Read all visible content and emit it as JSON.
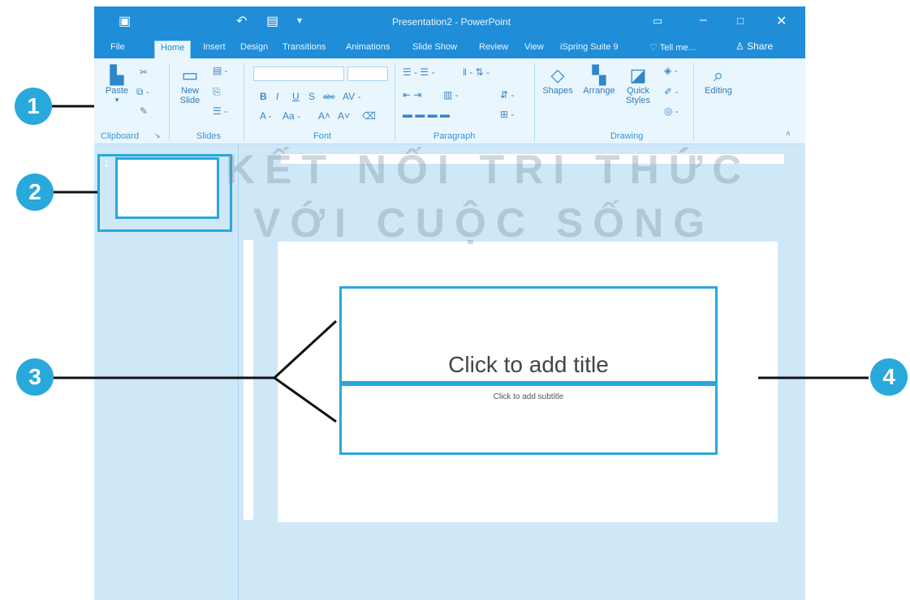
{
  "window": {
    "title": "Presentation2 - PowerPoint",
    "tabs": [
      "File",
      "Home",
      "Insert",
      "Design",
      "Transitions",
      "Animations",
      "Slide Show",
      "Review",
      "View",
      "iSpring Suite 9",
      "Tell me..."
    ],
    "active_tab": "Home",
    "share_label": "Share"
  },
  "ribbon": {
    "groups": [
      "Clipboard",
      "Slides",
      "Font",
      "Paragraph",
      "Drawing"
    ],
    "paste_label": "Paste",
    "new_slide_label_1": "New",
    "new_slide_label_2": "Slide",
    "shapes_label": "Shapes",
    "arrange_label": "Arrange",
    "quick_styles_label_1": "Quick",
    "quick_styles_label_2": "Styles",
    "editing_label": "Editing",
    "font_buttons": [
      "B",
      "I",
      "U",
      "S",
      "abc"
    ]
  },
  "thumbnails": {
    "slide_number": "1"
  },
  "slide": {
    "title_placeholder": "Click to add title",
    "subtitle_placeholder": "Click to add subtitle"
  },
  "watermark": {
    "line1": "KẾT NỐI TRI THỨC",
    "line2": "VỚI CUỘC SỐNG"
  },
  "callouts": [
    "1",
    "2",
    "3",
    "4"
  ],
  "colors": {
    "titlebar": "#1f8dd8",
    "accent": "#29a8dc",
    "ribbon_bg": "#eaf6fd",
    "pane_bg": "#cfe8f8"
  },
  "icons": [
    "save-icon",
    "undo-icon",
    "present-icon",
    "minimize-icon",
    "maximize-icon",
    "close-icon",
    "paste-icon",
    "cut-icon",
    "copy-icon",
    "format-painter-icon",
    "new-slide-icon",
    "shapes-icon",
    "arrange-icon",
    "quick-styles-icon",
    "find-icon",
    "user-icon"
  ]
}
